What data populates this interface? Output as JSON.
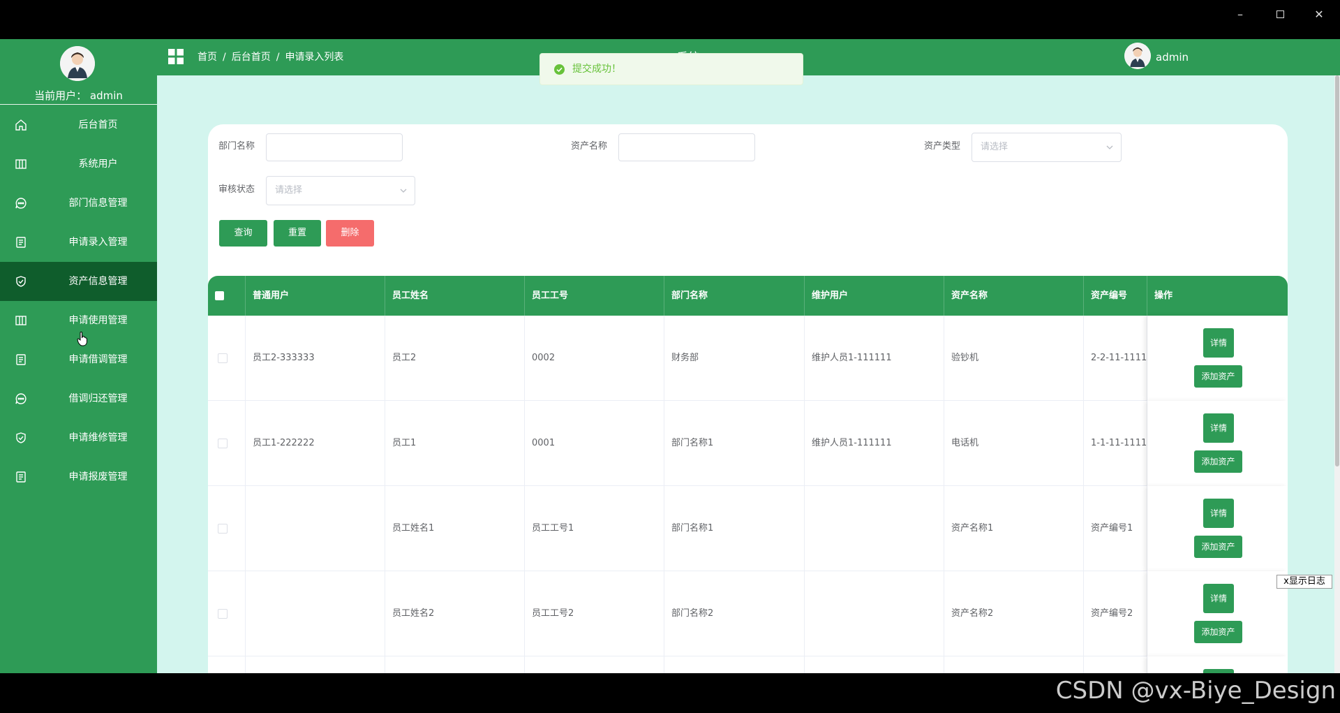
{
  "window": {
    "minimize_icon": "–",
    "close_icon": "✕"
  },
  "sidebar": {
    "current_user": "当前用户：   admin",
    "items": [
      {
        "label": "后台首页",
        "icon": "home-icon"
      },
      {
        "label": "系统用户",
        "icon": "columns-icon"
      },
      {
        "label": "部门信息管理",
        "icon": "chat-icon"
      },
      {
        "label": "申请录入管理",
        "icon": "document-icon"
      },
      {
        "label": "资产信息管理",
        "icon": "shield-icon",
        "active": true
      },
      {
        "label": "申请使用管理",
        "icon": "columns-icon"
      },
      {
        "label": "申请借调管理",
        "icon": "document-icon"
      },
      {
        "label": "借调归还管理",
        "icon": "chat-icon"
      },
      {
        "label": "申请维修管理",
        "icon": "shield-icon"
      },
      {
        "label": "申请报废管理",
        "icon": "document-icon"
      }
    ]
  },
  "header": {
    "breadcrumb": [
      "首页",
      "后台首页",
      "申请录入列表"
    ],
    "breadcrumb_sep": "/",
    "title": "系统",
    "user": "admin"
  },
  "toast": {
    "message": "提交成功！"
  },
  "search": {
    "dept_label": "部门名称",
    "dept_value": "",
    "asset_name_label": "资产名称",
    "asset_name_value": "",
    "asset_type_label": "资产类型",
    "asset_type_placeholder": "请选择",
    "audit_label": "审核状态",
    "audit_placeholder": "请选择",
    "query_btn": "查询",
    "reset_btn": "重置",
    "delete_btn": "删除"
  },
  "table": {
    "headers": [
      "普通用户",
      "员工姓名",
      "员工工号",
      "部门名称",
      "维护用户",
      "资产名称",
      "资产编号",
      "操作"
    ],
    "detail_btn": "详情",
    "add_btn": "添加资产",
    "rows": [
      [
        "员工2-333333",
        "员工2",
        "0002",
        "财务部",
        "维护人员1-111111",
        "验钞机",
        "2-2-11-1111"
      ],
      [
        "员工1-222222",
        "员工1",
        "0001",
        "部门名称1",
        "维护人员1-111111",
        "电话机",
        "1-1-11-1111"
      ],
      [
        "",
        "员工姓名1",
        "员工工号1",
        "部门名称1",
        "",
        "资产名称1",
        "资产编号1"
      ],
      [
        "",
        "员工姓名2",
        "员工工号2",
        "部门名称2",
        "",
        "资产名称2",
        "资产编号2"
      ]
    ]
  },
  "log_button": "x显示日志",
  "watermark": "CSDN @vx-Biye_Design",
  "colors": {
    "brand_green": "#2e9b56",
    "active_green": "#0f5d2c",
    "bg_mint": "#d3f5ee",
    "danger": "#f56c6c"
  }
}
